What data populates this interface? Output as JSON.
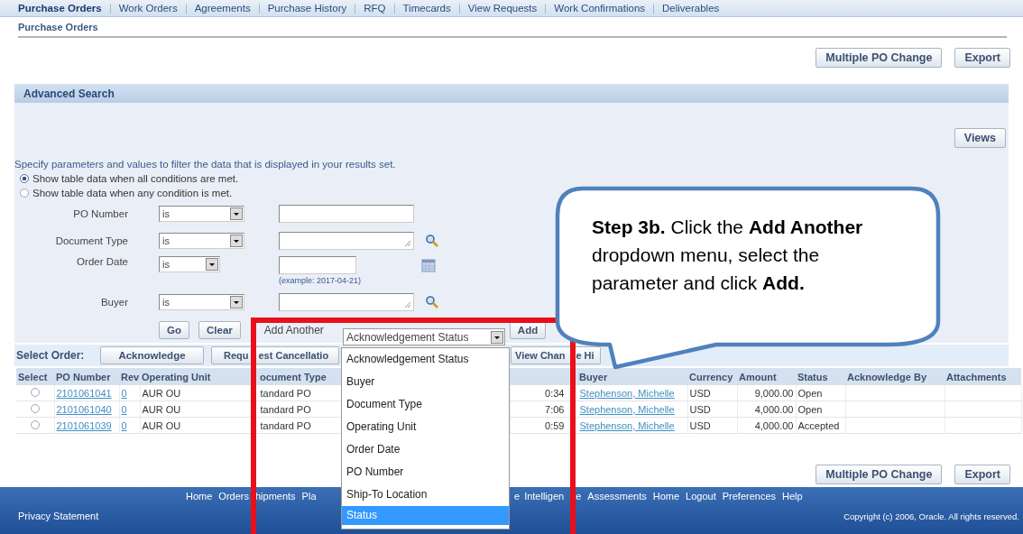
{
  "tabs": [
    {
      "label": "Purchase Orders",
      "selected": true
    },
    {
      "label": "Work Orders",
      "selected": false
    },
    {
      "label": "Agreements",
      "selected": false
    },
    {
      "label": "Purchase History",
      "selected": false
    },
    {
      "label": "RFQ",
      "selected": false
    },
    {
      "label": "Timecards",
      "selected": false
    },
    {
      "label": "View Requests",
      "selected": false
    },
    {
      "label": "Work Confirmations",
      "selected": false
    },
    {
      "label": "Deliverables",
      "selected": false
    }
  ],
  "page_title": "Purchase Orders",
  "top_buttons": [
    "Multiple PO Change",
    "Export"
  ],
  "search": {
    "title": "Advanced Search",
    "views_button": "Views",
    "instruction": "Specify parameters and values to filter the data that is displayed in your results set.",
    "match_options": [
      {
        "label": "Show table data when all conditions are met.",
        "selected": true
      },
      {
        "label": "Show table data when any condition is met.",
        "selected": false
      }
    ],
    "conditions": [
      {
        "label": "PO Number",
        "operator": "is",
        "kind": "text"
      },
      {
        "label": "Document Type",
        "operator": "is",
        "kind": "lookup"
      },
      {
        "label": "Order Date",
        "operator": "is",
        "kind": "date",
        "hint": "(example: 2017-04-21)"
      },
      {
        "label": "Buyer",
        "operator": "is",
        "kind": "lookup"
      }
    ],
    "go_button": "Go",
    "clear_button": "Clear",
    "add_another_label": "Add Another",
    "add_another_value": "Acknowledgement Status",
    "add_button": "Add"
  },
  "dropdown_options": [
    {
      "label": "Acknowledgement Status",
      "selected": false
    },
    {
      "label": "Buyer",
      "selected": false
    },
    {
      "label": "Document Type",
      "selected": false
    },
    {
      "label": "Operating Unit",
      "selected": false
    },
    {
      "label": "Order Date",
      "selected": false
    },
    {
      "label": "PO Number",
      "selected": false
    },
    {
      "label": "Ship-To Location",
      "selected": false
    },
    {
      "label": "Status",
      "selected": true
    }
  ],
  "select_order": {
    "label": "Select Order:",
    "buttons": [
      {
        "parts": [
          "Acknowledge"
        ]
      },
      {
        "parts": [
          "Requ",
          "est Cancellatio"
        ]
      },
      {
        "parts": [
          "View Chan",
          "e Hi"
        ]
      }
    ]
  },
  "table": {
    "columns": [
      "Select",
      "PO Number",
      "Rev",
      "Operating Unit",
      "ocument Type",
      "Buyer",
      "Currency",
      "Amount",
      "Status",
      "Acknowledge By",
      "Attachments"
    ],
    "rows": [
      {
        "selected": false,
        "po_number": "2101061041",
        "rev": "0",
        "operating_unit": "AUR OU",
        "document_type": "tandard PO",
        "column_6": "0:34",
        "buyer": "Stephenson, Michelle",
        "currency": "USD",
        "amount": "9,000.00",
        "status": "Open"
      },
      {
        "selected": false,
        "po_number": "2101061040",
        "rev": "0",
        "operating_unit": "AUR OU",
        "document_type": "tandard PO",
        "column_6": "7:06",
        "buyer": "Stephenson, Michelle",
        "currency": "USD",
        "amount": "4,000.00",
        "status": "Open"
      },
      {
        "selected": false,
        "po_number": "2101061039",
        "rev": "0",
        "operating_unit": "AUR OU",
        "document_type": "tandard PO",
        "column_6": "0:59",
        "buyer": "Stephenson, Michelle",
        "currency": "USD",
        "amount": "4,000.00",
        "status": "Accepted"
      }
    ]
  },
  "bottom_buttons": [
    "Multiple PO Change",
    "Export"
  ],
  "footer": {
    "links_left": [
      "Home",
      "Orders",
      "hipments",
      "Pla"
    ],
    "links_right": [
      "e",
      "Intelligen",
      "e",
      "Assessments",
      "Home",
      "Logout",
      "Preferences",
      "Help"
    ],
    "privacy": "Privacy Statement",
    "copyright": "Copyright (c) 2006, Oracle. All rights reserved."
  },
  "callout": {
    "text": "**Step 3b.** Click the **Add Another** dropdown menu, select the parameter and click **Add.**"
  }
}
